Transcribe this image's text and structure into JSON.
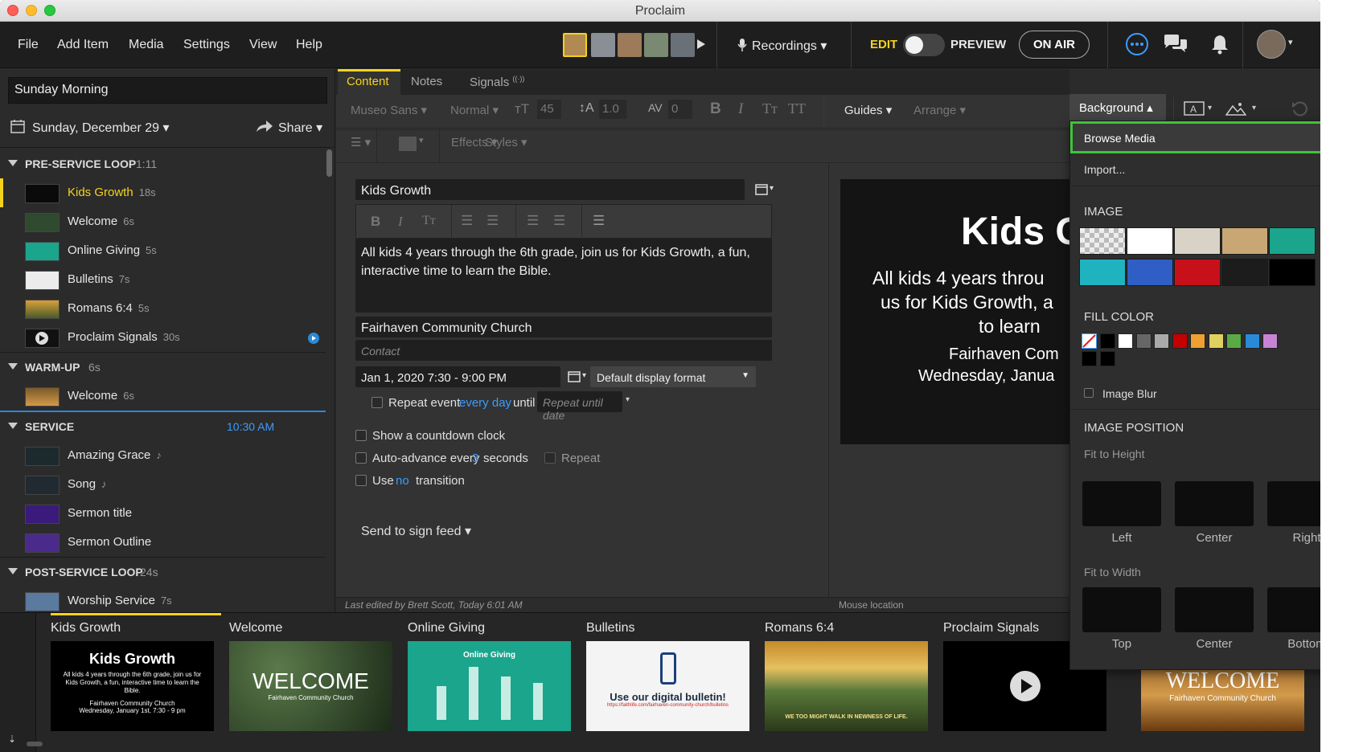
{
  "app": {
    "title": "Proclaim"
  },
  "menu": [
    "File",
    "Add Item",
    "Media",
    "Settings",
    "View",
    "Help"
  ],
  "toolbar": {
    "recordings": "Recordings",
    "edit": "EDIT",
    "preview": "PREVIEW",
    "on_air": "ON AIR"
  },
  "sidebar": {
    "presentation_name": "Sunday Morning",
    "date": "Sunday, December 29",
    "share": "Share",
    "sections": [
      {
        "title": "PRE-SERVICE LOOP",
        "duration": "1:11"
      },
      {
        "title": "WARM-UP",
        "duration": "6s"
      },
      {
        "title": "SERVICE",
        "duration": "10:30 AM"
      },
      {
        "title": "POST-SERVICE LOOP",
        "duration": "24s"
      }
    ],
    "items": [
      {
        "label": "Kids Growth",
        "duration": "18s"
      },
      {
        "label": "Welcome",
        "duration": "6s"
      },
      {
        "label": "Online Giving",
        "duration": "5s"
      },
      {
        "label": "Bulletins",
        "duration": "7s"
      },
      {
        "label": "Romans 6:4",
        "duration": "5s"
      },
      {
        "label": "Proclaim Signals",
        "duration": "30s"
      },
      {
        "label": "Welcome",
        "duration": "6s"
      },
      {
        "label": "Amazing Grace",
        "duration": "♪"
      },
      {
        "label": "Song",
        "duration": "♪"
      },
      {
        "label": "Sermon title",
        "duration": ""
      },
      {
        "label": "Sermon Outline",
        "duration": ""
      },
      {
        "label": "Worship Service",
        "duration": "7s"
      }
    ]
  },
  "tabs": [
    "Content",
    "Notes",
    "Signals"
  ],
  "signals_badge": "((·))",
  "format": {
    "font": "Museo Sans",
    "weight": "Normal",
    "size": "45",
    "line_height": "1.0",
    "spacing": "0",
    "guides": "Guides",
    "arrange": "Arrange",
    "background": "Background",
    "effects": "Effects",
    "styles": "Styles"
  },
  "editor": {
    "title": "Kids Growth",
    "body": "All kids 4 years through the 6th grade, join us for Kids Growth, a fun, interactive time to learn the Bible.",
    "location": "Fairhaven Community Church",
    "contact_placeholder": "Contact",
    "datetime": "Jan 1, 2020 7:30 - 9:00 PM",
    "display_format": "Default display format",
    "repeat_event": "Repeat event",
    "every_day": "every day",
    "until": "until",
    "repeat_until_placeholder": "Repeat until date",
    "countdown": "Show a  countdown clock",
    "auto_advance_a": "Auto-advance every",
    "auto_advance_n": "3",
    "auto_advance_b": "seconds",
    "repeat": "Repeat",
    "use": "Use",
    "no": "no",
    "transition": "transition",
    "send_to_sign_feed": "Send to sign feed",
    "last_edited": "Last edited by Brett Scott, Today 6:01 AM",
    "mouse_location": "Mouse location"
  },
  "preview": {
    "title": "Kids G",
    "line1": "All kids 4 years throu",
    "line2": "us for Kids Growth, a",
    "line3": "to learn",
    "loc": "Fairhaven Com",
    "date": "Wednesday, Janua"
  },
  "dropdown": {
    "browse_media": "Browse Media",
    "import": "Import...",
    "image_header": "IMAGE",
    "fill_color_header": "FILL COLOR",
    "image_blur": "Image Blur",
    "image_position_header": "IMAGE POSITION",
    "fit_height": "Fit to Height",
    "fit_width": "Fit to Width",
    "height_positions": [
      "Left",
      "Center",
      "Right"
    ],
    "width_positions": [
      "Top",
      "Center",
      "Bottom"
    ],
    "image_swatches": [
      "#cfcfcf",
      "#ffffff",
      "#d8d3c6",
      "#c9a775",
      "#1aa58c",
      "#1fb3c0",
      "#2f5fc4",
      "#c8101a",
      "#1c1c1c",
      "#000000"
    ],
    "fill_colors": [
      "none",
      "#000000",
      "#ffffff",
      "#666666",
      "#aaaaaa",
      "#c40000",
      "#f0a030",
      "#e0d060",
      "#5aaa44",
      "#2a8ad8",
      "#c884d4",
      "#000000",
      "#000000"
    ]
  },
  "slides": [
    {
      "label": "Kids Growth",
      "title": "Kids Growth",
      "body": "All kids 4 years through the 6th grade, join us for Kids Growth, a fun, interactive time to learn the Bible.",
      "loc": "Fairhaven Community Church",
      "date": "Wednesday, January 1st, 7:30 - 9 pm"
    },
    {
      "label": "Welcome",
      "title": "WELCOME",
      "sub": "Fairhaven Community Church"
    },
    {
      "label": "Online Giving",
      "title": "Online Giving"
    },
    {
      "label": "Bulletins",
      "title": "Use our digital bulletin!",
      "url": "https://faithlife.com/fairhaven-community-church/bulletins"
    },
    {
      "label": "Romans 6:4",
      "verse": "WE TOO MIGHT WALK IN NEWNESS OF LIFE."
    },
    {
      "label": "Proclaim Signals"
    },
    {
      "label": "",
      "title": "WELCOME",
      "sub": "Fairhaven Community Church"
    }
  ],
  "colors": {
    "accent_yellow": "#f5d21e",
    "link_blue": "#3b9cff",
    "highlight_green": "#3ec43a"
  }
}
